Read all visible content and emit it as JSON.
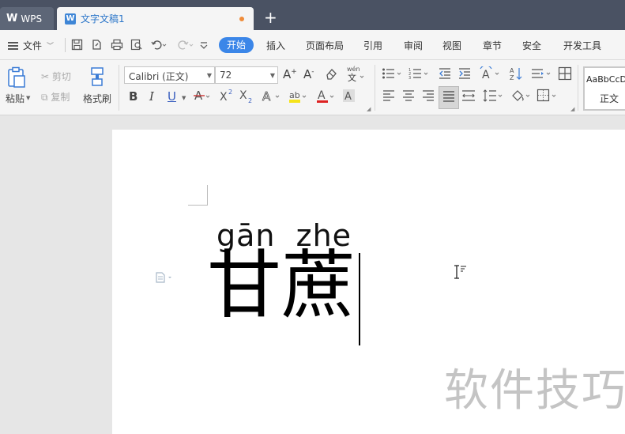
{
  "tabs": {
    "wps_label": "WPS",
    "doc_label": "文字文稿1",
    "doc_icon_letter": "W",
    "add_symbol": "+"
  },
  "menu": {
    "file_label": "文件",
    "start": "开始",
    "insert": "插入",
    "page_layout": "页面布局",
    "reference": "引用",
    "review": "审阅",
    "view": "视图",
    "section": "章节",
    "security": "安全",
    "dev_tools": "开发工具"
  },
  "ribbon": {
    "paste": "粘贴",
    "cut": "剪切",
    "copy": "复制",
    "format_painter": "格式刷",
    "font_name": "Calibri (正文)",
    "font_size": "72",
    "bold": "B",
    "italic": "I",
    "underline": "U",
    "style_preview": "AaBbCcD",
    "style_name": "正文"
  },
  "document": {
    "pinyin": "gān  zhe",
    "hanzi": "甘蔗",
    "watermark": "软件技巧"
  },
  "colors": {
    "accent": "#3b86e8",
    "tabbar": "#4a5263",
    "modified_dot": "#f08c3a"
  }
}
